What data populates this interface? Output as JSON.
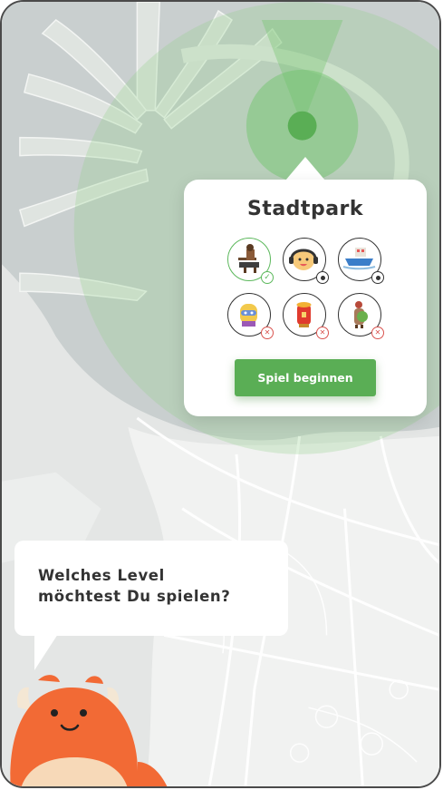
{
  "popup": {
    "title": "Stadtpark",
    "button_label": "Spiel beginnen",
    "levels": [
      {
        "status": "completed",
        "icon": "figure-at-laptop-icon"
      },
      {
        "status": "available",
        "icon": "character-headphones-icon"
      },
      {
        "status": "available",
        "icon": "boat-icon"
      },
      {
        "status": "locked",
        "icon": "character-yellow-icon"
      },
      {
        "status": "locked",
        "icon": "red-lantern-icon"
      },
      {
        "status": "locked",
        "icon": "figure-green-shield-icon"
      }
    ]
  },
  "speech": {
    "line1": "Welches Level",
    "line2": "möchtest Du spielen?"
  },
  "colors": {
    "accent_green": "#5aae55",
    "completed": "#5cb85c",
    "locked": "#d9534f",
    "mascot_orange": "#f26a35"
  }
}
